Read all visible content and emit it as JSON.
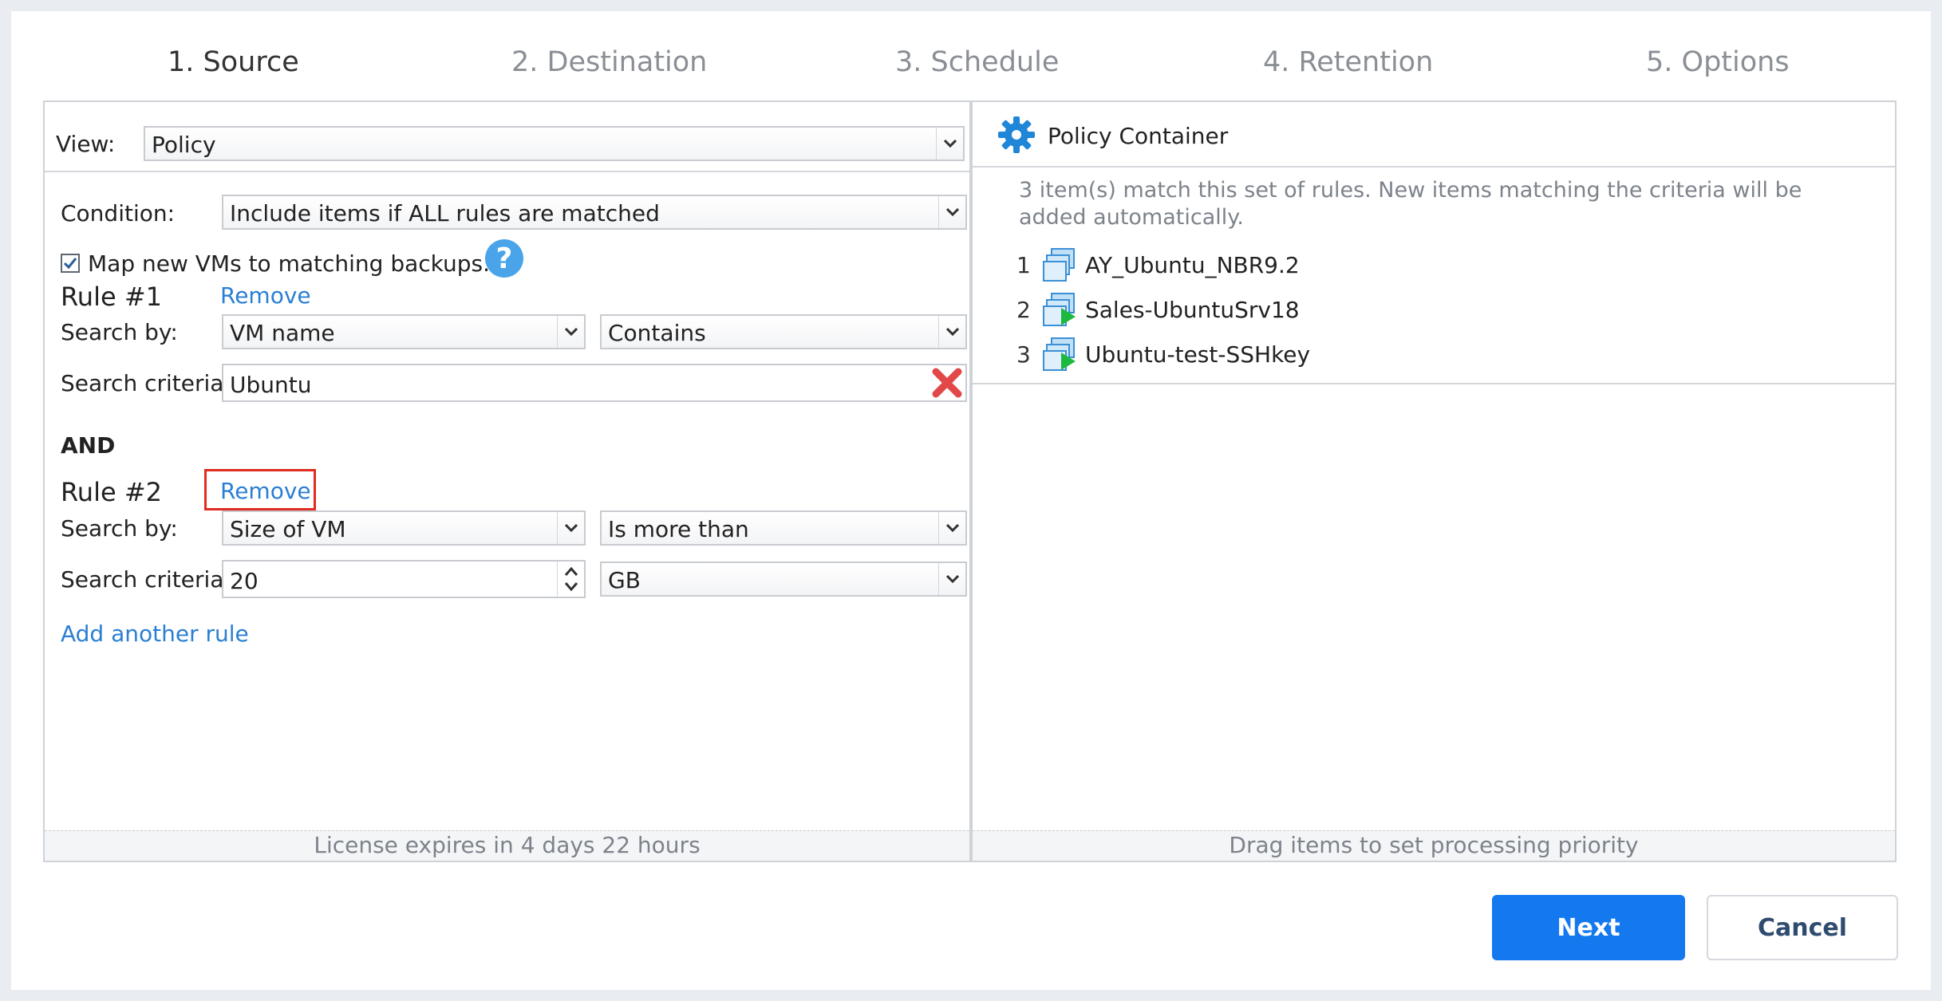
{
  "steps": [
    "1. Source",
    "2. Destination",
    "3. Schedule",
    "4. Retention",
    "5. Options"
  ],
  "left": {
    "view_label": "View:",
    "view_value": "Policy",
    "condition_label": "Condition:",
    "condition_value": "Include items if ALL rules are matched",
    "map_checkbox_label": "Map new VMs to matching backups.",
    "rule1": {
      "title": "Rule #1",
      "remove": "Remove",
      "search_by_label": "Search by:",
      "search_by_value": "VM name",
      "operator_value": "Contains",
      "criteria_label": "Search criteria:",
      "criteria_value": "Ubuntu"
    },
    "and_label": "AND",
    "rule2": {
      "title": "Rule #2",
      "remove": "Remove",
      "search_by_label": "Search by:",
      "search_by_value": "Size of VM",
      "operator_value": "Is more than",
      "criteria_label": "Search criteria:",
      "criteria_value": "20",
      "unit_value": "GB"
    },
    "add_rule": "Add another rule",
    "footer": "License expires in 4 days 22 hours"
  },
  "right": {
    "title": "Policy Container",
    "info": "3 item(s) match this set of rules. New items matching the criteria will be added automatically.",
    "items": [
      {
        "num": "1",
        "name": "AY_Ubuntu_NBR9.2"
      },
      {
        "num": "2",
        "name": "Sales-UbuntuSrv18"
      },
      {
        "num": "3",
        "name": "Ubuntu-test-SSHkey"
      }
    ],
    "footer": "Drag items to set processing priority"
  },
  "buttons": {
    "next": "Next",
    "cancel": "Cancel"
  },
  "colors": {
    "accent": "#1479ef",
    "link": "#2a7fd4",
    "highlight_box": "#e02b20",
    "remove_icon": "#e34848",
    "vm_running": "#1db83e"
  }
}
